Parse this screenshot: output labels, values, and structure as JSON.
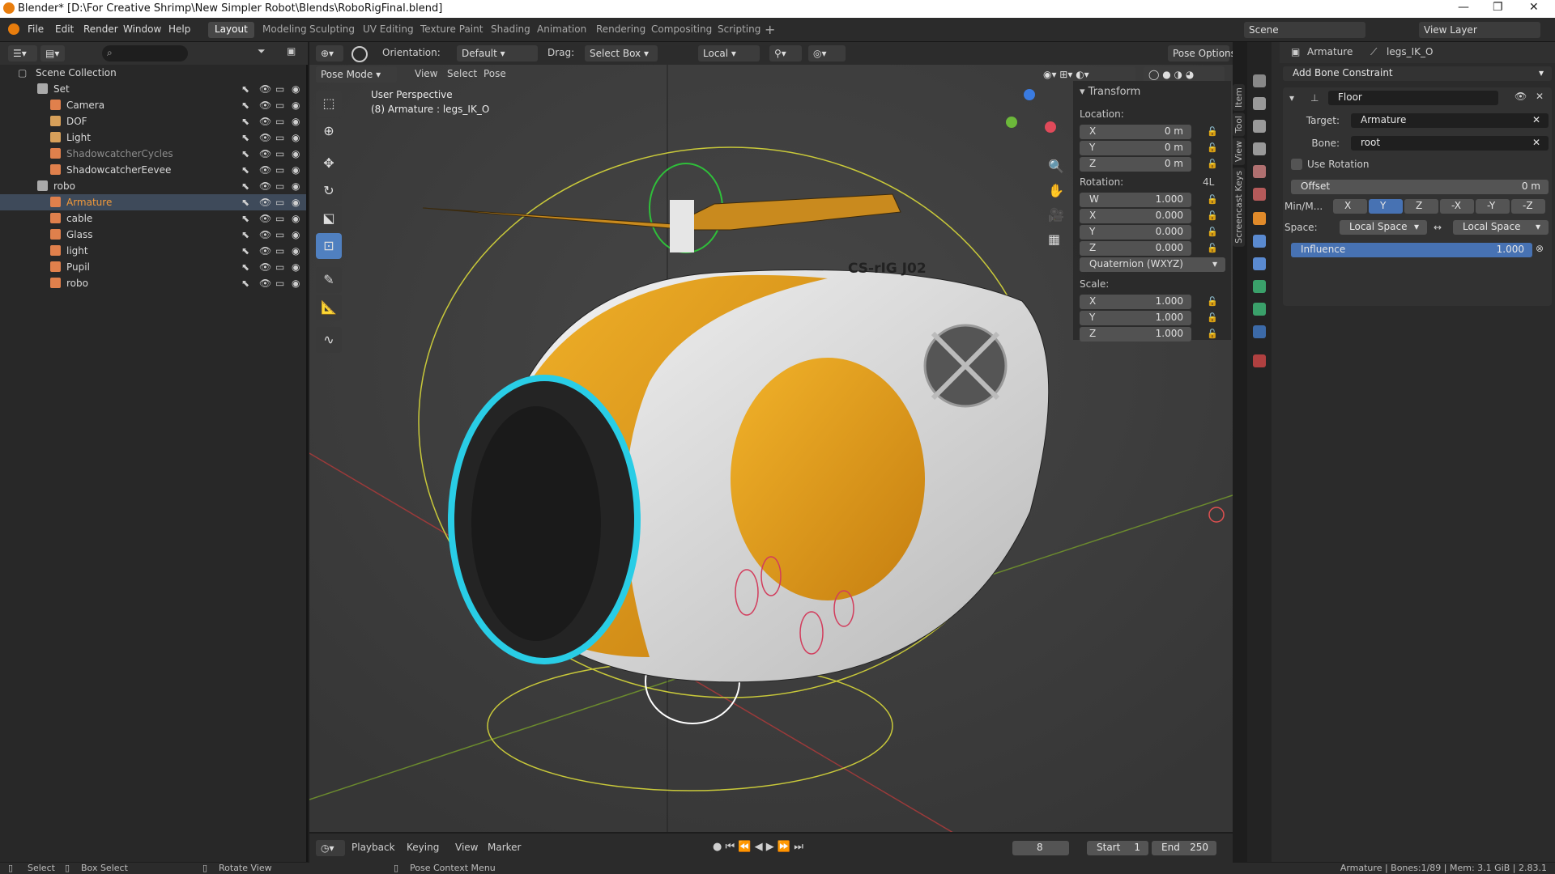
{
  "window": {
    "title": "Blender* [D:\\For Creative Shrimp\\New Simpler Robot\\Blends\\RoboRigFinal.blend]"
  },
  "menu": [
    "File",
    "Edit",
    "Render",
    "Window",
    "Help"
  ],
  "workspaces": [
    "Layout",
    "Modeling",
    "Sculpting",
    "UV Editing",
    "Texture Paint",
    "Shading",
    "Animation",
    "Rendering",
    "Compositing",
    "Scripting"
  ],
  "scene": {
    "scene_label": "Scene",
    "view_layer": "View Layer"
  },
  "outliner": {
    "title": "Scene Collection",
    "rows": [
      {
        "label": "Set",
        "color": "#aaaaaa"
      },
      {
        "label": "Camera",
        "color": "#e0804c"
      },
      {
        "label": "DOF",
        "color": "#d7a05a"
      },
      {
        "label": "Light",
        "color": "#d7a05a"
      },
      {
        "label": "ShadowcatcherCycles",
        "color": "#e0804c"
      },
      {
        "label": "ShadowcatcherEevee",
        "color": "#e0804c"
      },
      {
        "label": "robo",
        "color": "#aaaaaa"
      },
      {
        "label": "Armature",
        "color": "#e0804c"
      },
      {
        "label": "cable",
        "color": "#e0804c"
      },
      {
        "label": "Glass",
        "color": "#e0804c"
      },
      {
        "label": "light",
        "color": "#e0804c"
      },
      {
        "label": "Pupil",
        "color": "#e0804c"
      },
      {
        "label": "robo",
        "color": "#e0804c"
      }
    ]
  },
  "viewport": {
    "header": {
      "orientation_label": "Orientation:",
      "orientation_value": "Default",
      "drag_label": "Drag:",
      "drag_value": "Select Box",
      "pivot": "Local",
      "pose_options": "Pose Options"
    },
    "header2": {
      "mode": "Pose Mode",
      "view": "View",
      "select": "Select",
      "pose": "Pose"
    },
    "overlay_text": {
      "line1": "User Perspective",
      "line2": "(8) Armature : legs_IK_O"
    },
    "decal": "CS-rIG J02"
  },
  "npanel": {
    "section": "Transform",
    "location_label": "Location:",
    "location": [
      {
        "k": "X",
        "v": "0 m"
      },
      {
        "k": "Y",
        "v": "0 m"
      },
      {
        "k": "Z",
        "v": "0 m"
      }
    ],
    "rotation_label": "Rotation:",
    "rotation_mode_short": "4L",
    "rotation": [
      {
        "k": "W",
        "v": "1.000"
      },
      {
        "k": "X",
        "v": "0.000"
      },
      {
        "k": "Y",
        "v": "0.000"
      },
      {
        "k": "Z",
        "v": "0.000"
      }
    ],
    "rotation_mode": "Quaternion (WXYZ)",
    "scale_label": "Scale:",
    "scale": [
      {
        "k": "X",
        "v": "1.000"
      },
      {
        "k": "Y",
        "v": "1.000"
      },
      {
        "k": "Z",
        "v": "1.000"
      }
    ],
    "tabs": [
      "Item",
      "Tool",
      "View",
      "Screencast Keys"
    ]
  },
  "properties": {
    "breadcrumb_object": "Armature",
    "breadcrumb_bone": "legs_IK_O",
    "add_constraint": "Add Bone Constraint",
    "constraint_name": "Floor",
    "target_label": "Target:",
    "target_value": "Armature",
    "bone_label": "Bone:",
    "bone_value": "root",
    "use_rotation": "Use Rotation",
    "offset_label": "Offset",
    "offset_value": "0 m",
    "minmax_label": "Min/M...",
    "axes": [
      "X",
      "Y",
      "Z",
      "-X",
      "-Y",
      "-Z"
    ],
    "active_axis": "Y",
    "space_label": "Space:",
    "space_owner": "Local Space",
    "space_target": "Local Space",
    "influence_label": "Influence",
    "influence_value": "1.000"
  },
  "timeline": {
    "playback": "Playback",
    "keying": "Keying",
    "view": "View",
    "marker": "Marker",
    "frame": "8",
    "start_label": "Start",
    "start": "1",
    "end_label": "End",
    "end": "250"
  },
  "status": {
    "select": "Select",
    "box_select": "Box Select",
    "rotate_view": "Rotate View",
    "context_menu": "Pose Context Menu",
    "info": "Armature | Bones:1/89 | Mem: 3.1 GiB | 2.83.1"
  }
}
